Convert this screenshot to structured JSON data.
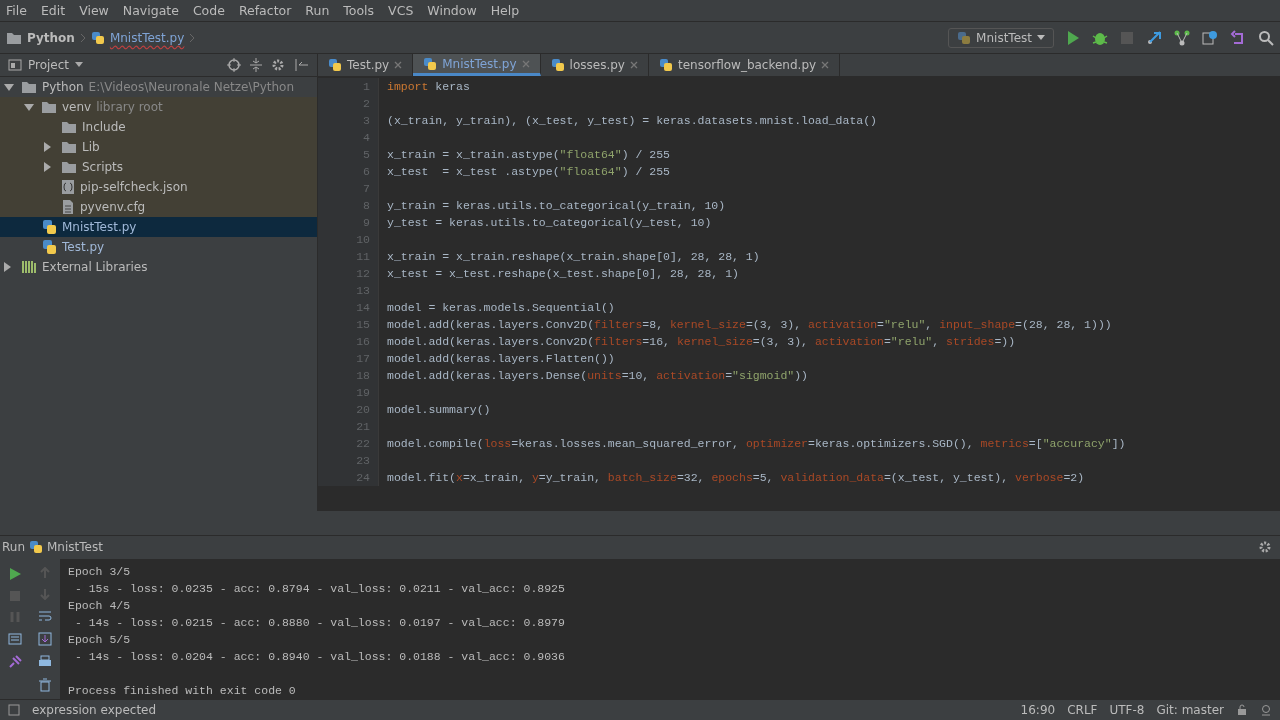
{
  "menu": [
    "File",
    "Edit",
    "View",
    "Navigate",
    "Code",
    "Refactor",
    "Run",
    "Tools",
    "VCS",
    "Window",
    "Help"
  ],
  "breadcrumb": [
    "Python",
    "MnistTest.py"
  ],
  "run_config": "MnistTest",
  "project_panel": {
    "title": "Project",
    "tree": [
      {
        "label": "Python",
        "note": "E:\\Videos\\Neuronale Netze\\Python",
        "kind": "folder",
        "expanded": true,
        "selected": false,
        "children": [
          {
            "label": "venv",
            "note": "library root",
            "kind": "folder",
            "expanded": true,
            "selected": false,
            "children": [
              {
                "label": "Include",
                "kind": "folder",
                "selected": false
              },
              {
                "label": "Lib",
                "kind": "folder",
                "expanded": false,
                "selected": false
              },
              {
                "label": "Scripts",
                "kind": "folder",
                "expanded": false,
                "selected": false
              },
              {
                "label": "pip-selfcheck.json",
                "kind": "json",
                "selected": false
              },
              {
                "label": "pyvenv.cfg",
                "kind": "text",
                "selected": false
              }
            ]
          },
          {
            "label": "MnistTest.py",
            "kind": "python",
            "selected": true
          },
          {
            "label": "Test.py",
            "kind": "python",
            "selected": false
          }
        ]
      },
      {
        "label": "External Libraries",
        "kind": "libraries",
        "expanded": false,
        "selected": false
      }
    ]
  },
  "tabs": [
    {
      "label": "Test.py",
      "selected": false
    },
    {
      "label": "MnistTest.py",
      "selected": true
    },
    {
      "label": "losses.py",
      "selected": false
    },
    {
      "label": "tensorflow_backend.py",
      "selected": false
    }
  ],
  "code": [
    {
      "number": "1",
      "tokens": [
        {
          "kind": "kw",
          "text": "import"
        },
        {
          "kind": "plain",
          "text": " keras"
        }
      ]
    },
    {
      "number": "2"
    },
    {
      "number": "3",
      "tokens": [
        {
          "kind": "plain",
          "text": "(x_train, y_train), (x_test, y_test) = keras.datasets.mnist.load_data()"
        }
      ]
    },
    {
      "number": "4"
    },
    {
      "number": "5",
      "tokens": [
        {
          "kind": "plain",
          "text": "x_train = x_train.astype("
        },
        {
          "kind": "str",
          "text": "\"float64\""
        },
        {
          "kind": "plain",
          "text": ") / 255"
        }
      ]
    },
    {
      "number": "6",
      "tokens": [
        {
          "kind": "plain",
          "text": "x_test  = x_test .astype("
        },
        {
          "kind": "str",
          "text": "\"float64\""
        },
        {
          "kind": "plain",
          "text": ") / 255"
        }
      ]
    },
    {
      "number": "7"
    },
    {
      "number": "8",
      "tokens": [
        {
          "kind": "plain",
          "text": "y_train = keras.utils.to_categorical(y_train, 10)"
        }
      ]
    },
    {
      "number": "9",
      "tokens": [
        {
          "kind": "plain",
          "text": "y_test = keras.utils.to_categorical(y_test, 10)"
        }
      ]
    },
    {
      "number": "10"
    },
    {
      "number": "11",
      "tokens": [
        {
          "kind": "plain",
          "text": "x_train = x_train.reshape(x_train.shape[0], 28, 28, 1)"
        }
      ]
    },
    {
      "number": "12",
      "tokens": [
        {
          "kind": "plain",
          "text": "x_test = x_test.reshape(x_test.shape[0], 28, 28, 1)"
        }
      ]
    },
    {
      "number": "13"
    },
    {
      "number": "14",
      "tokens": [
        {
          "kind": "plain",
          "text": "model = keras.models.Sequential()"
        }
      ]
    },
    {
      "number": "15",
      "tokens": [
        {
          "kind": "plain",
          "text": "model.add(keras.layers.Conv2D("
        },
        {
          "kind": "param",
          "text": "filters"
        },
        {
          "kind": "plain",
          "text": "=8, "
        },
        {
          "kind": "param",
          "text": "kernel_size"
        },
        {
          "kind": "plain",
          "text": "=(3, 3), "
        },
        {
          "kind": "param",
          "text": "activation"
        },
        {
          "kind": "plain",
          "text": "="
        },
        {
          "kind": "str",
          "text": "\"relu\""
        },
        {
          "kind": "plain",
          "text": ", "
        },
        {
          "kind": "param",
          "text": "input_shape"
        },
        {
          "kind": "plain",
          "text": "=(28, 28, 1)))"
        }
      ]
    },
    {
      "number": "16",
      "tokens": [
        {
          "kind": "plain",
          "text": "model.add(keras.layers.Conv2D("
        },
        {
          "kind": "param",
          "text": "filters"
        },
        {
          "kind": "plain",
          "text": "=16, "
        },
        {
          "kind": "param",
          "text": "kernel_size"
        },
        {
          "kind": "plain",
          "text": "=(3, 3), "
        },
        {
          "kind": "param",
          "text": "activation"
        },
        {
          "kind": "plain",
          "text": "="
        },
        {
          "kind": "str",
          "text": "\"relu\""
        },
        {
          "kind": "plain",
          "text": ", "
        },
        {
          "kind": "param",
          "text": "strides"
        },
        {
          "kind": "plain",
          "text": "=))"
        }
      ]
    },
    {
      "number": "17",
      "tokens": [
        {
          "kind": "plain",
          "text": "model.add(keras.layers.Flatten())"
        }
      ]
    },
    {
      "number": "18",
      "tokens": [
        {
          "kind": "plain",
          "text": "model.add(keras.layers.Dense("
        },
        {
          "kind": "param",
          "text": "units"
        },
        {
          "kind": "plain",
          "text": "=10, "
        },
        {
          "kind": "param",
          "text": "activation"
        },
        {
          "kind": "plain",
          "text": "="
        },
        {
          "kind": "str",
          "text": "\"sigmoid\""
        },
        {
          "kind": "plain",
          "text": "))"
        }
      ]
    },
    {
      "number": "19"
    },
    {
      "number": "20",
      "tokens": [
        {
          "kind": "plain",
          "text": "model.summary()"
        }
      ]
    },
    {
      "number": "21"
    },
    {
      "number": "22",
      "tokens": [
        {
          "kind": "plain",
          "text": "model.compile("
        },
        {
          "kind": "param",
          "text": "loss"
        },
        {
          "kind": "plain",
          "text": "=keras.losses.mean_squared_error, "
        },
        {
          "kind": "param",
          "text": "optimizer"
        },
        {
          "kind": "plain",
          "text": "=keras.optimizers.SGD(), "
        },
        {
          "kind": "param",
          "text": "metrics"
        },
        {
          "kind": "plain",
          "text": "=["
        },
        {
          "kind": "str",
          "text": "\"accuracy\""
        },
        {
          "kind": "plain",
          "text": "])"
        }
      ]
    },
    {
      "number": "23"
    },
    {
      "number": "24",
      "tokens": [
        {
          "kind": "plain",
          "text": "model.fit("
        },
        {
          "kind": "param",
          "text": "x"
        },
        {
          "kind": "plain",
          "text": "=x_train, "
        },
        {
          "kind": "param",
          "text": "y"
        },
        {
          "kind": "plain",
          "text": "=y_train, "
        },
        {
          "kind": "param",
          "text": "batch_size"
        },
        {
          "kind": "plain",
          "text": "=32, "
        },
        {
          "kind": "param",
          "text": "epochs"
        },
        {
          "kind": "plain",
          "text": "=5, "
        },
        {
          "kind": "param",
          "text": "validation_data"
        },
        {
          "kind": "plain",
          "text": "=(x_test, y_test), "
        },
        {
          "kind": "param",
          "text": "verbose"
        },
        {
          "kind": "plain",
          "text": "=2)"
        }
      ]
    }
  ],
  "run_panel": {
    "label": "Run",
    "config": "MnistTest",
    "console": [
      {
        "kind": "output",
        "text": "Epoch 3/5"
      },
      {
        "kind": "output",
        "text": " - 15s - loss: 0.0235 - acc: 0.8794 - val_loss: 0.0211 - val_acc: 0.8925"
      },
      {
        "kind": "output",
        "text": "Epoch 4/5"
      },
      {
        "kind": "output",
        "text": " - 14s - loss: 0.0215 - acc: 0.8880 - val_loss: 0.0197 - val_acc: 0.8979"
      },
      {
        "kind": "output",
        "text": "Epoch 5/5"
      },
      {
        "kind": "output",
        "text": " - 14s - loss: 0.0204 - acc: 0.8940 - val_loss: 0.0188 - val_acc: 0.9036"
      },
      {
        "kind": "exit",
        "text": "Process finished with exit code 0"
      }
    ]
  },
  "status_bar": {
    "message": "expression expected",
    "position": "16:90",
    "line_separator": "CRLF",
    "encoding": "UTF-8",
    "vcs": "Git: master"
  }
}
